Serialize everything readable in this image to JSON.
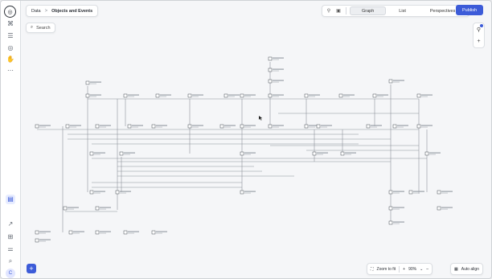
{
  "breadcrumb": {
    "parent": "Data",
    "separator": ">",
    "current": "Objects and Events"
  },
  "search": {
    "label": "Search"
  },
  "view_tabs": [
    {
      "label": "Graph",
      "active": true
    },
    {
      "label": "List",
      "active": false
    },
    {
      "label": "Perspectives",
      "active": false
    }
  ],
  "publish_label": "Publish",
  "zoom": {
    "fit_label": "Zoom to fit",
    "minus": "+",
    "value": "90%",
    "plus": "–"
  },
  "auto_align_label": "Auto align",
  "icons": {
    "logo": "app-logo-icon",
    "rail": [
      "objects-icon",
      "table-icon",
      "compass-icon",
      "hand-icon",
      "more-icon",
      "graph-view-icon",
      "export-icon",
      "grid-icon",
      "sliders-icon",
      "search-icon"
    ],
    "toolbar": [
      "filter-icon",
      "layout-icon"
    ]
  },
  "colors": {
    "accent": "#3c5bd8",
    "edge": "#8c9199",
    "node_border": "#444a52"
  }
}
